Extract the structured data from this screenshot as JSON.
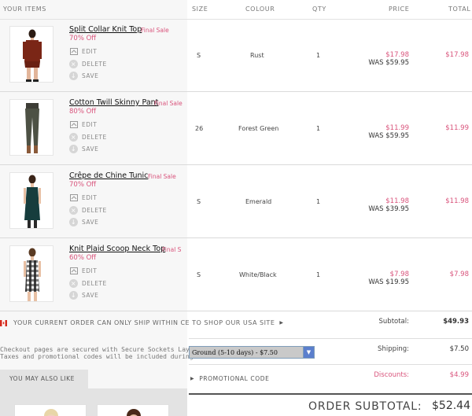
{
  "headers": {
    "items": "YOUR ITEMS",
    "size": "SIZE",
    "colour": "COLOUR",
    "qty": "QTY",
    "price": "PRICE",
    "total": "TOTAL"
  },
  "actions": {
    "edit": "EDIT",
    "delete": "DELETE",
    "save": "SAVE"
  },
  "items": [
    {
      "name": "Split Collar Knit Top",
      "final_sale": "Final Sale",
      "discount": "70% Off",
      "size": "S",
      "colour": "Rust",
      "qty": "1",
      "price": "$17.98",
      "was": "WAS $59.95",
      "total": "$17.98"
    },
    {
      "name": "Cotton Twill Skinny Pant",
      "final_sale": "Final Sale",
      "discount": "80% Off",
      "size": "26",
      "colour": "Forest Green",
      "qty": "1",
      "price": "$11.99",
      "was": "WAS $59.95",
      "total": "$11.99"
    },
    {
      "name": "Crêpe de Chine Tunic",
      "final_sale": "Final Sale",
      "discount": "70% Off",
      "size": "S",
      "colour": "Emerald",
      "qty": "1",
      "price": "$11.98",
      "was": "WAS $39.95",
      "total": "$11.98"
    },
    {
      "name": "Knit Plaid Scoop Neck Top",
      "final_sale": "Final S",
      "discount": "60% Off",
      "size": "S",
      "colour": "White/Black",
      "qty": "1",
      "price": "$7.98",
      "was": "WAS $19.95",
      "total": "$7.98"
    }
  ],
  "shipping_notice": "YOUR CURRENT ORDER CAN ONLY SHIP WITHIN CE TO SHOP OUR USA SITE",
  "secure_text": {
    "line1": "Checkout pages are secured with Secure Sockets Layer",
    "line2": "Taxes and promotional codes will be included during c"
  },
  "summary": {
    "subtotal_label": "Subtotal:",
    "subtotal_value": "$49.93",
    "shipping_label": "Shipping:",
    "shipping_value": "$7.50",
    "discounts_label": "Discounts:",
    "discounts_value": "$4.99"
  },
  "shipping_select": {
    "selected": "Ground (5-10 days) - $7.50"
  },
  "promo_label": "PROMOTIONAL CODE",
  "also_like": "YOU MAY ALSO LIKE",
  "order_subtotal": {
    "label": "ORDER SUBTOTAL:",
    "value": "$52.44"
  },
  "colors": {
    "accent_pink": "#d9547c",
    "select_arrow": "#5b7fcd"
  }
}
